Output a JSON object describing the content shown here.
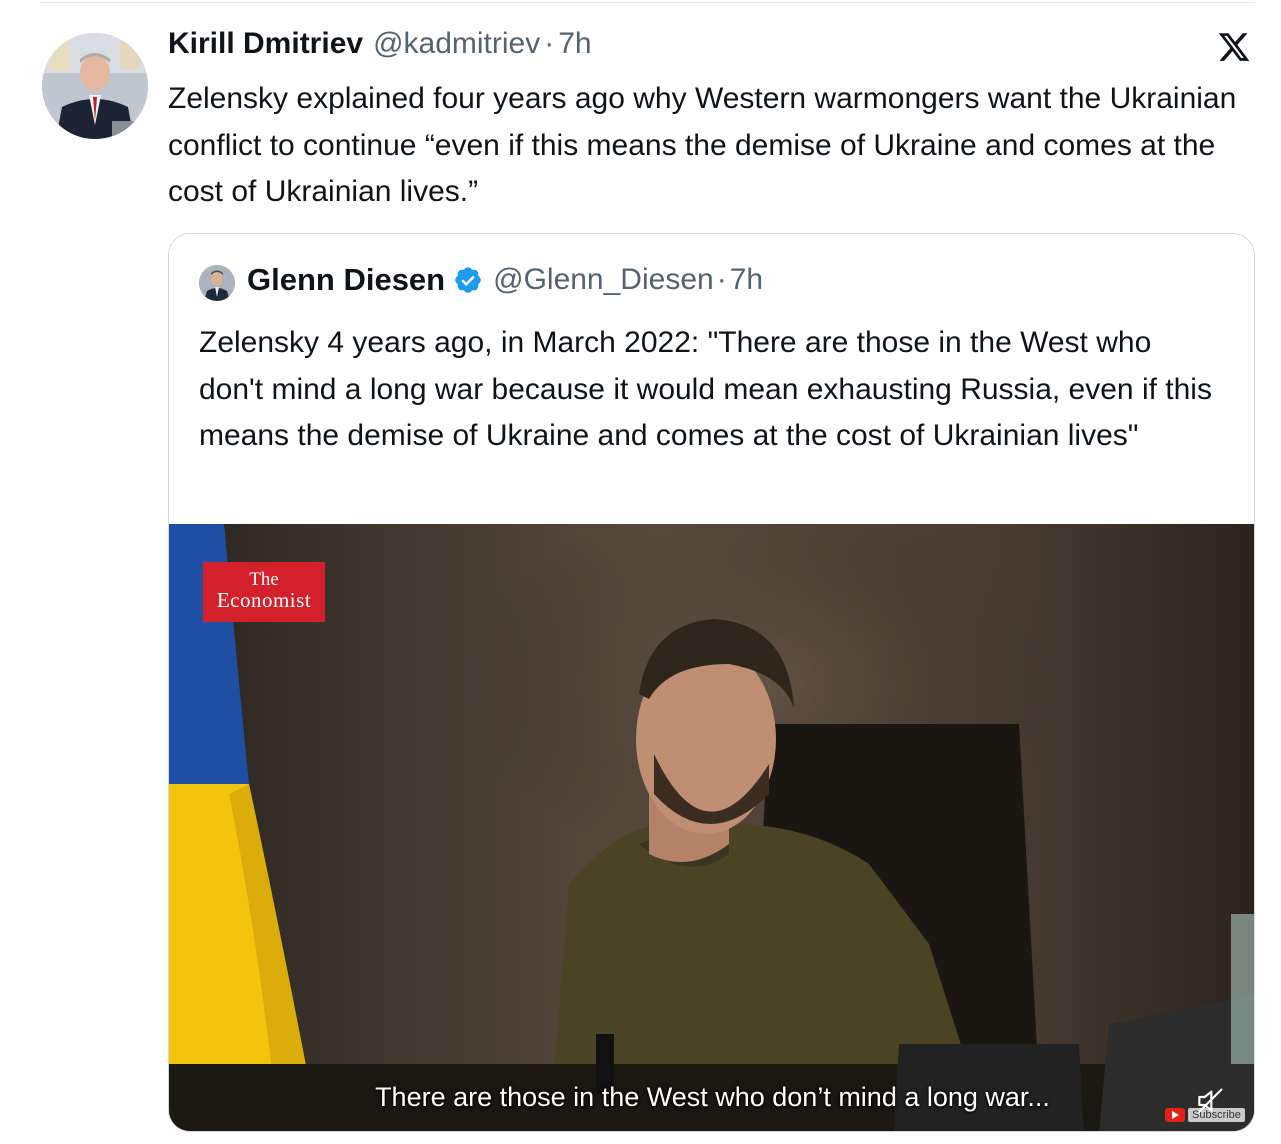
{
  "tweet": {
    "author_name": "Kirill Dmitriev",
    "author_handle": "@kadmitriev",
    "separator": "·",
    "time": "7h",
    "text": "Zelensky explained four years ago why Western warmongers want the Ukrainian conflict to continue “even if this means the demise of Ukraine and comes at the cost of Ukrainian lives.”"
  },
  "quoted_tweet": {
    "author_name": "Glenn Diesen",
    "verified": true,
    "author_handle": "@Glenn_Diesen",
    "separator": "·",
    "time": "7h",
    "text": "Zelensky 4 years ago, in March 2022: \"There are those in the West who don't mind a long war because it would mean exhausting Russia, even if this means the demise of Ukraine and comes at the cost of Ukrainian lives\""
  },
  "video": {
    "logo_line1": "The",
    "logo_line2": "Economist",
    "caption": "There are those in the West who don’t mind a long war...",
    "subscribe_label": "Subscribe",
    "muted": true
  },
  "icons": {
    "platform": "x-logo-icon",
    "verified": "verified-badge-icon",
    "mute": "speaker-muted-icon"
  },
  "colors": {
    "text": "#0f1419",
    "secondary": "#536471",
    "border": "#cfd9de",
    "verified_blue": "#1d9bf0",
    "economist_red": "#d3202a",
    "flag_blue": "#1f4fa3",
    "flag_yellow": "#f2c40e"
  }
}
